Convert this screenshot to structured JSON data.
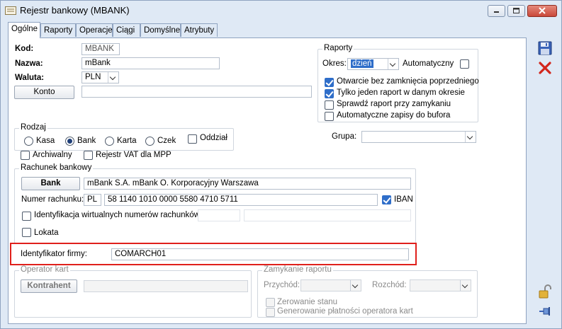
{
  "window": {
    "title": "Rejestr bankowy (MBANK)"
  },
  "tabs": [
    "Ogólne",
    "Raporty",
    "Operacje",
    "Ciągi",
    "Domyślne",
    "Atrybuty"
  ],
  "general": {
    "kod_label": "Kod:",
    "kod_value": "MBANK",
    "nazwa_label": "Nazwa:",
    "nazwa_value": "mBank",
    "waluta_label": "Waluta:",
    "waluta_value": "PLN",
    "konto_button": "Konto",
    "konto_value": ""
  },
  "raporty": {
    "title": "Raporty",
    "okres_label": "Okres:",
    "okres_value": "dzień",
    "automatyczny_label": "Automatyczny",
    "checks": [
      {
        "label": "Otwarcie bez zamknięcia poprzedniego",
        "checked": true
      },
      {
        "label": "Tylko jeden raport w danym okresie",
        "checked": true
      },
      {
        "label": "Sprawdź raport przy zamykaniu",
        "checked": false
      },
      {
        "label": "Automatyczne zapisy do bufora",
        "checked": false
      }
    ]
  },
  "rodzaj": {
    "title": "Rodzaj",
    "options": [
      "Kasa",
      "Bank",
      "Karta",
      "Czek"
    ],
    "selected": "Bank",
    "oddzial_label": "Oddział"
  },
  "grupa_label": "Grupa:",
  "archiwalny_label": "Archiwalny",
  "rejestr_vat_label": "Rejestr VAT dla MPP",
  "rachunek": {
    "title": "Rachunek bankowy",
    "bank_button": "Bank",
    "bank_value": "mBank S.A. mBank O. Korporacyjny Warszawa",
    "numer_label": "Numer rachunku:",
    "country": "PL",
    "numer_value": "58 1140 1010 0000 5580 4710 5711",
    "iban_label": "IBAN",
    "wirtualne_label": "Identyfikacja wirtualnych numerów rachunków",
    "lokata_label": "Lokata"
  },
  "identyfikator": {
    "label": "Identyfikator firmy:",
    "value": "COMARCH01"
  },
  "operator": {
    "title": "Operator kart",
    "button": "Kontrahent",
    "value": ""
  },
  "zamykanie": {
    "title": "Zamykanie raportu",
    "przychod_label": "Przychód:",
    "rozchod_label": "Rozchód:",
    "zerowanie_label": "Zerowanie stanu",
    "generowanie_label": "Generowanie płatności operatora kart"
  },
  "colors": {
    "accent": "#2f6ec9",
    "highlight_border": "#e0201c",
    "close_button": "#c9483a"
  },
  "icons": [
    "app-icon",
    "minimize-icon",
    "restore-icon",
    "close-icon",
    "save-icon",
    "cancel-icon",
    "lock-icon",
    "pin-icon"
  ]
}
